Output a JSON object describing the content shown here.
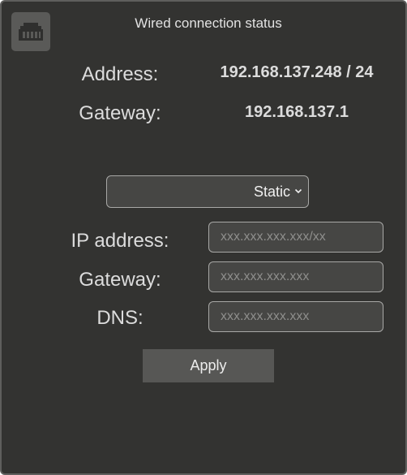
{
  "header": {
    "title": "Wired connection status",
    "icon": "ethernet-port-icon"
  },
  "status": {
    "address_label": "Address:",
    "address_value": "192.168.137.248 / 24",
    "gateway_label": "Gateway:",
    "gateway_value": "192.168.137.1"
  },
  "config": {
    "mode_selected": "Static",
    "ip_label": "IP address:",
    "ip_placeholder": "xxx.xxx.xxx.xxx/xx",
    "gateway_label": "Gateway:",
    "gateway_placeholder": "xxx.xxx.xxx.xxx",
    "dns_label": "DNS:",
    "dns_placeholder": "xxx.xxx.xxx.xxx",
    "apply_label": "Apply"
  },
  "colors": {
    "panel_background": "#333331",
    "input_background": "#464644",
    "button_background": "#575755",
    "text": "#dcdcdc"
  }
}
